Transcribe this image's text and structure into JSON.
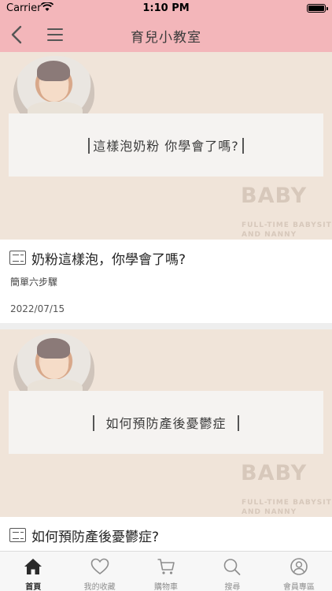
{
  "status_bar": {
    "carrier": "Carrier",
    "time": "1:10 PM"
  },
  "nav": {
    "title": "育兒小教室"
  },
  "articles": [
    {
      "banner_text": "這樣泡奶粉 你學會了嗎?",
      "brand": "BABY",
      "brand_sub_1": "FULL-TIME BABYSITTER",
      "brand_sub_2": "AND NANNY",
      "title": "奶粉這樣泡，你學會了嗎?",
      "subtitle": "簡單六步驟",
      "date": "2022/07/15"
    },
    {
      "banner_text": "如何預防產後憂鬱症",
      "brand": "BABY",
      "brand_sub_1": "FULL-TIME BABYSITTER",
      "brand_sub_2": "AND NANNY",
      "title": "如何預防產後憂鬱症?"
    }
  ],
  "tabs": [
    {
      "label": "首頁",
      "icon": "home-icon",
      "active": true
    },
    {
      "label": "我的收藏",
      "icon": "heart-icon"
    },
    {
      "label": "購物車",
      "icon": "cart-icon"
    },
    {
      "label": "搜尋",
      "icon": "search-icon"
    },
    {
      "label": "會員專區",
      "icon": "user-icon"
    }
  ],
  "colors": {
    "header_bg": "#f3b6ba",
    "cover_bg": "#f0e4d9",
    "brand_text": "#d7c8bb"
  }
}
